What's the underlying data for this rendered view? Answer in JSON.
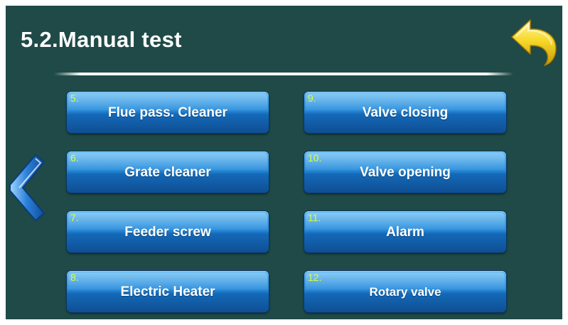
{
  "screen": {
    "title": "5.2.Manual test",
    "background_color": "#1f4a47"
  },
  "navigation": {
    "back_icon": "back-arrow-icon",
    "back_color": "#f2d21d",
    "prev_icon": "chevron-left-icon",
    "prev_color": "#2b7fd8"
  },
  "buttons": [
    {
      "number": "5.",
      "label": "Flue pass. Cleaner"
    },
    {
      "number": "6.",
      "label": "Grate cleaner"
    },
    {
      "number": "7.",
      "label": "Feeder screw"
    },
    {
      "number": "8.",
      "label": "Electric Heater"
    },
    {
      "number": "9.",
      "label": "Valve closing"
    },
    {
      "number": "10.",
      "label": "Valve opening"
    },
    {
      "number": "11.",
      "label": "Alarm"
    },
    {
      "number": "12.",
      "label": "Rotary valve"
    }
  ],
  "button_style": {
    "fill_color": "#1c7bcf",
    "number_color": "#d8ff3a",
    "label_color": "#ffffff"
  }
}
